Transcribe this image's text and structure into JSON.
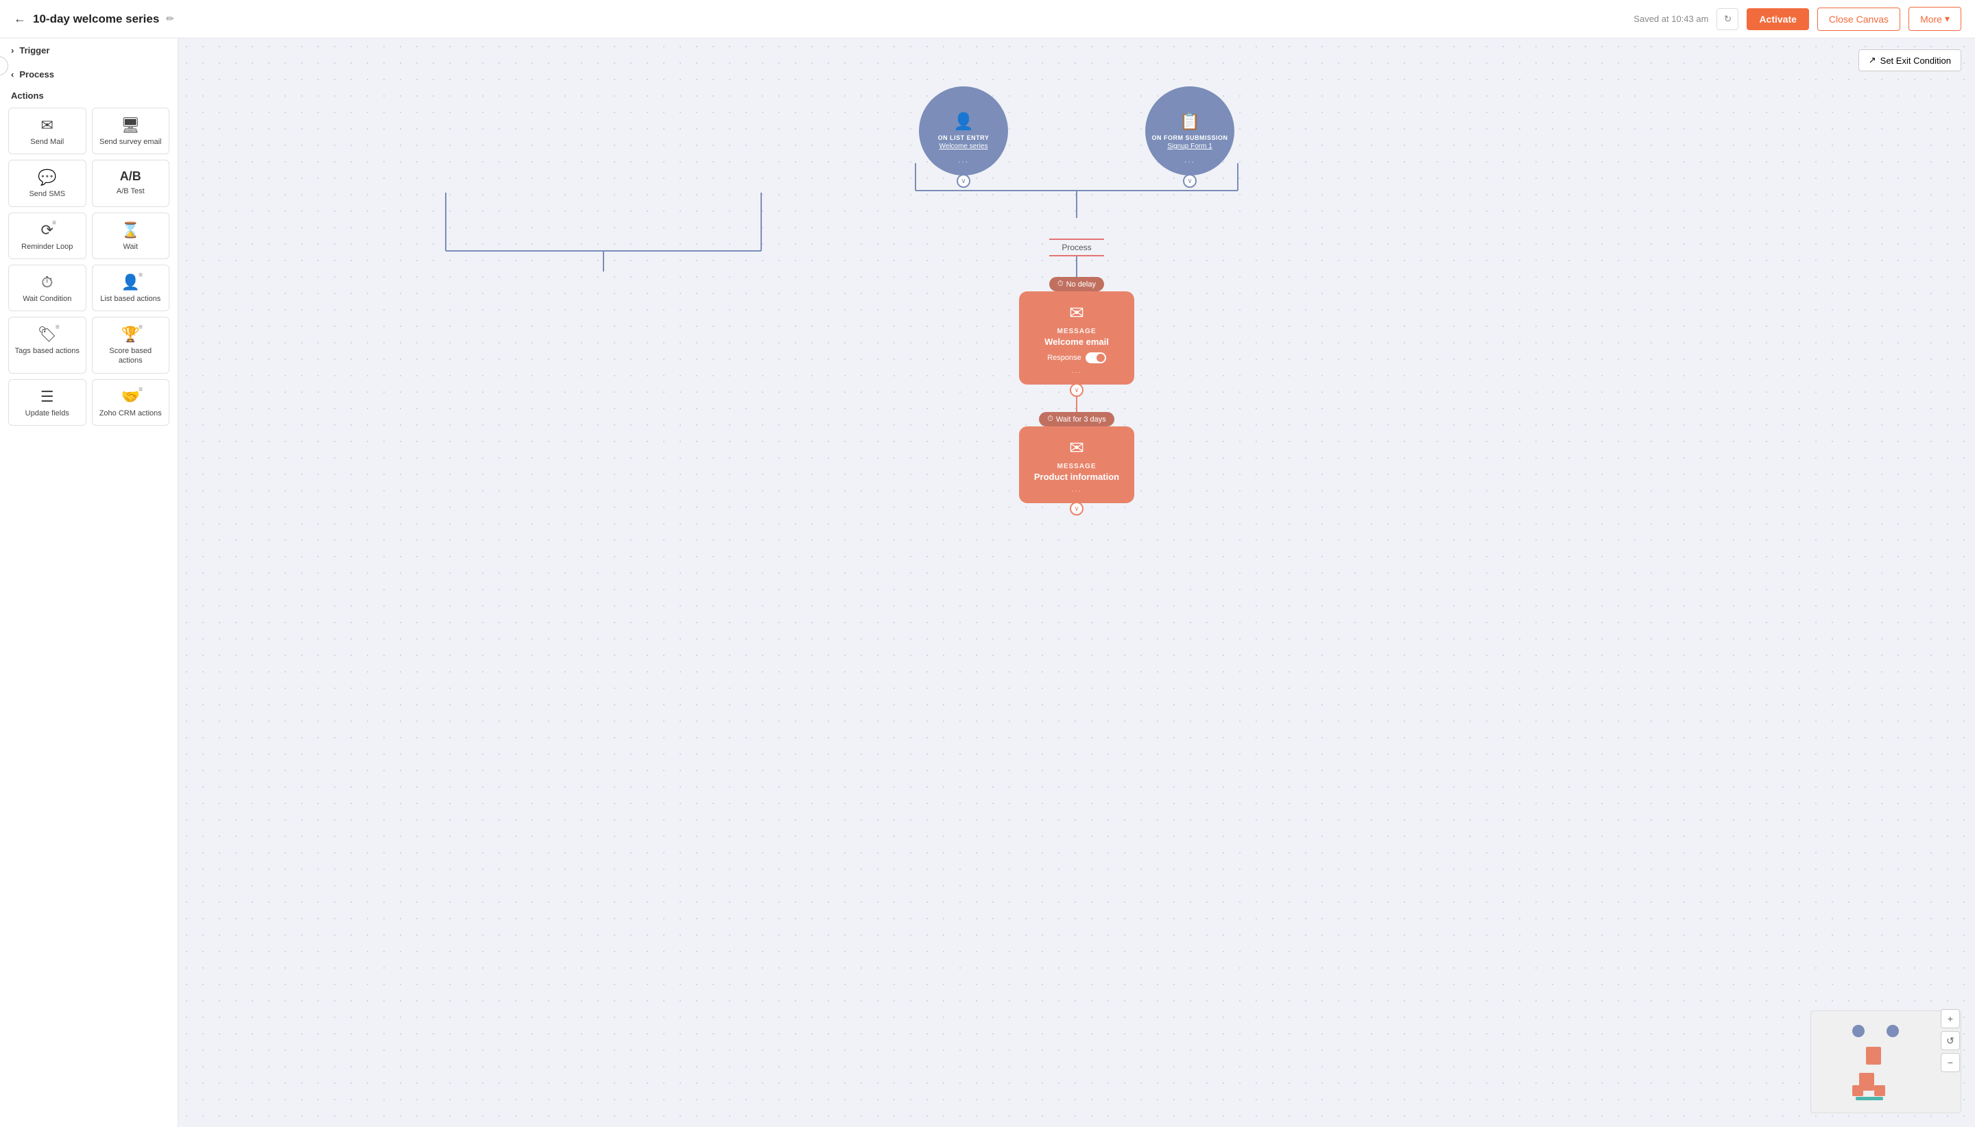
{
  "header": {
    "back_label": "←",
    "title": "10-day welcome series",
    "edit_icon": "✏",
    "saved_text": "Saved at 10:43 am",
    "activate_label": "Activate",
    "close_canvas_label": "Close Canvas",
    "more_label": "More",
    "more_arrow": "▾"
  },
  "sidebar": {
    "trigger_label": "Trigger",
    "trigger_chevron": "›",
    "process_label": "Process",
    "process_chevron": "‹",
    "actions_label": "Actions",
    "items": [
      {
        "id": "send-mail",
        "icon": "✉",
        "label": "Send Mail",
        "stack": false
      },
      {
        "id": "send-survey-email",
        "icon": "🖥",
        "label": "Send survey email",
        "stack": false
      },
      {
        "id": "send-sms",
        "icon": "💬",
        "label": "Send SMS",
        "stack": false
      },
      {
        "id": "ab-test",
        "icon": "A/B",
        "label": "A/B Test",
        "stack": false,
        "is_text": true
      },
      {
        "id": "reminder-loop",
        "icon": "⟳",
        "label": "Reminder Loop",
        "stack": true
      },
      {
        "id": "wait",
        "icon": "⌛",
        "label": "Wait",
        "stack": false
      },
      {
        "id": "wait-condition",
        "icon": "⏱",
        "label": "Wait Condition",
        "stack": false
      },
      {
        "id": "list-based-actions",
        "icon": "👤",
        "label": "List based actions",
        "stack": true
      },
      {
        "id": "tags-based-actions",
        "icon": "🏷",
        "label": "Tags based actions",
        "stack": true
      },
      {
        "id": "score-based-actions",
        "icon": "🏆",
        "label": "Score based actions",
        "stack": true
      },
      {
        "id": "update-fields",
        "icon": "☰",
        "label": "Update fields",
        "stack": false
      },
      {
        "id": "zoho-crm-actions",
        "icon": "🤝",
        "label": "Zoho CRM actions",
        "stack": true
      }
    ]
  },
  "canvas": {
    "set_exit_label": "Set Exit Condition",
    "trigger1": {
      "title": "ON LIST ENTRY",
      "subtitle": "Welcome series"
    },
    "trigger2": {
      "title": "ON FORM SUBMISSION",
      "subtitle": "Signup Form 1"
    },
    "process_label": "Process",
    "step1": {
      "delay": "No delay",
      "type": "MESSAGE",
      "name": "Welcome email",
      "response_label": "Response"
    },
    "step2": {
      "delay": "Wait for 3 days",
      "type": "MESSAGE",
      "name": "Product information"
    }
  },
  "colors": {
    "trigger_blue": "#7b8db8",
    "step_orange": "#e8836a",
    "delay_dark": "#c17060",
    "connector": "#e8836a",
    "connector_blue": "#7b8db8"
  }
}
